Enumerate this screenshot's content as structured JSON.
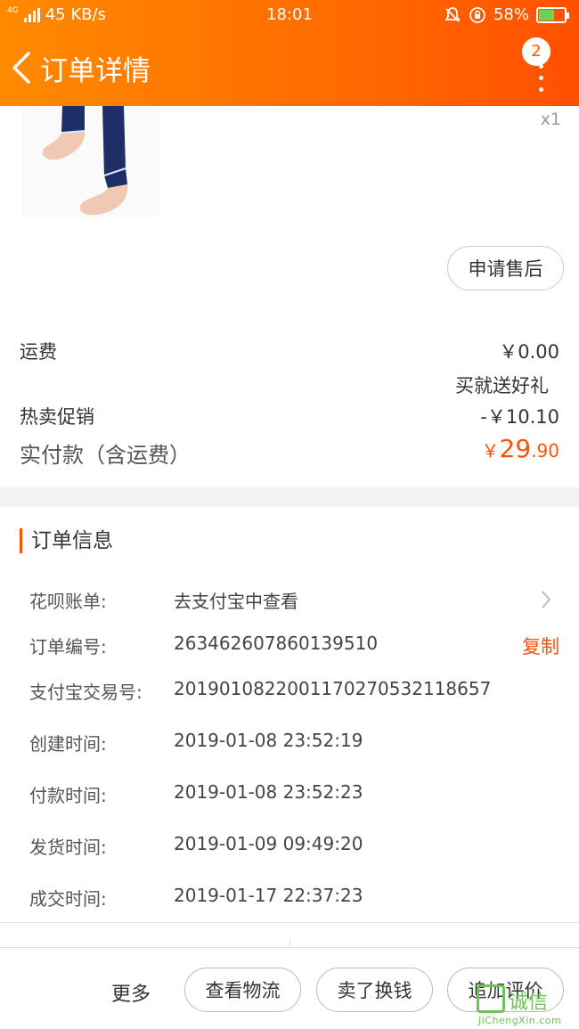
{
  "status_bar": {
    "network_type": "4G",
    "speed": "45 KB/s",
    "time": "18:01",
    "battery": "58%"
  },
  "nav": {
    "title": "订单详情",
    "badge_count": "2"
  },
  "product": {
    "quantity": "x1",
    "aftersale_label": "申请售后"
  },
  "pricing": {
    "shipping_label": "运费",
    "shipping_value": "￥0.00",
    "gift": "买就送好礼",
    "promo_label": "热卖促销",
    "promo_value": "-￥10.10",
    "total_label": "实付款（含运费）",
    "total_currency": "￥",
    "total_int": "29",
    "total_dec": ".90"
  },
  "order_info": {
    "title": "订单信息",
    "huabei_label": "花呗账单:",
    "huabei_value": "去支付宝中查看",
    "order_no_label": "订单编号:",
    "order_no_value": "263462607860139510",
    "copy_label": "复制",
    "alipay_label": "支付宝交易号:",
    "alipay_value": "2019010822001170270532118657",
    "created_label": "创建时间:",
    "created_value": "2019-01-08 23:52:19",
    "paid_label": "付款时间:",
    "paid_value": "2019-01-08 23:52:23",
    "shipped_label": "发货时间:",
    "shipped_value": "2019-01-09 09:49:20",
    "closed_label": "成交时间:",
    "closed_value": "2019-01-17 22:37:23"
  },
  "bottom": {
    "more": "更多",
    "logistics": "查看物流",
    "resell": "卖了换钱",
    "review": "追加评价"
  },
  "watermark": {
    "text": "诚信",
    "sub": "JiChengXin.com"
  },
  "colors": {
    "accent": "#ff5000",
    "header_start": "#ff8a00",
    "header_end": "#ff5000"
  }
}
